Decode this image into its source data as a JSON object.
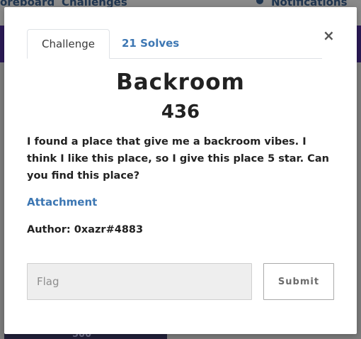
{
  "background": {
    "nav_items": [
      "oreboard",
      "Challenges",
      "Notifications"
    ],
    "tile_value": "500"
  },
  "modal": {
    "close_label": "×",
    "tabs": [
      {
        "label": "Challenge",
        "active": true
      },
      {
        "label": "21 Solves",
        "active": false
      }
    ],
    "title": "Backroom",
    "points": "436",
    "description": "I found a place that give me a backroom vibes. I think I like this place, so I give this place 5 star. Can you find this place?",
    "attachment_label": "Attachment",
    "author": "Author: 0xazr#4883",
    "flag_input": {
      "placeholder": "Flag",
      "value": ""
    },
    "submit_label": "Submit"
  },
  "colors": {
    "link": "#3d77b3",
    "text": "#222222",
    "header_band": "#2b1a57"
  }
}
